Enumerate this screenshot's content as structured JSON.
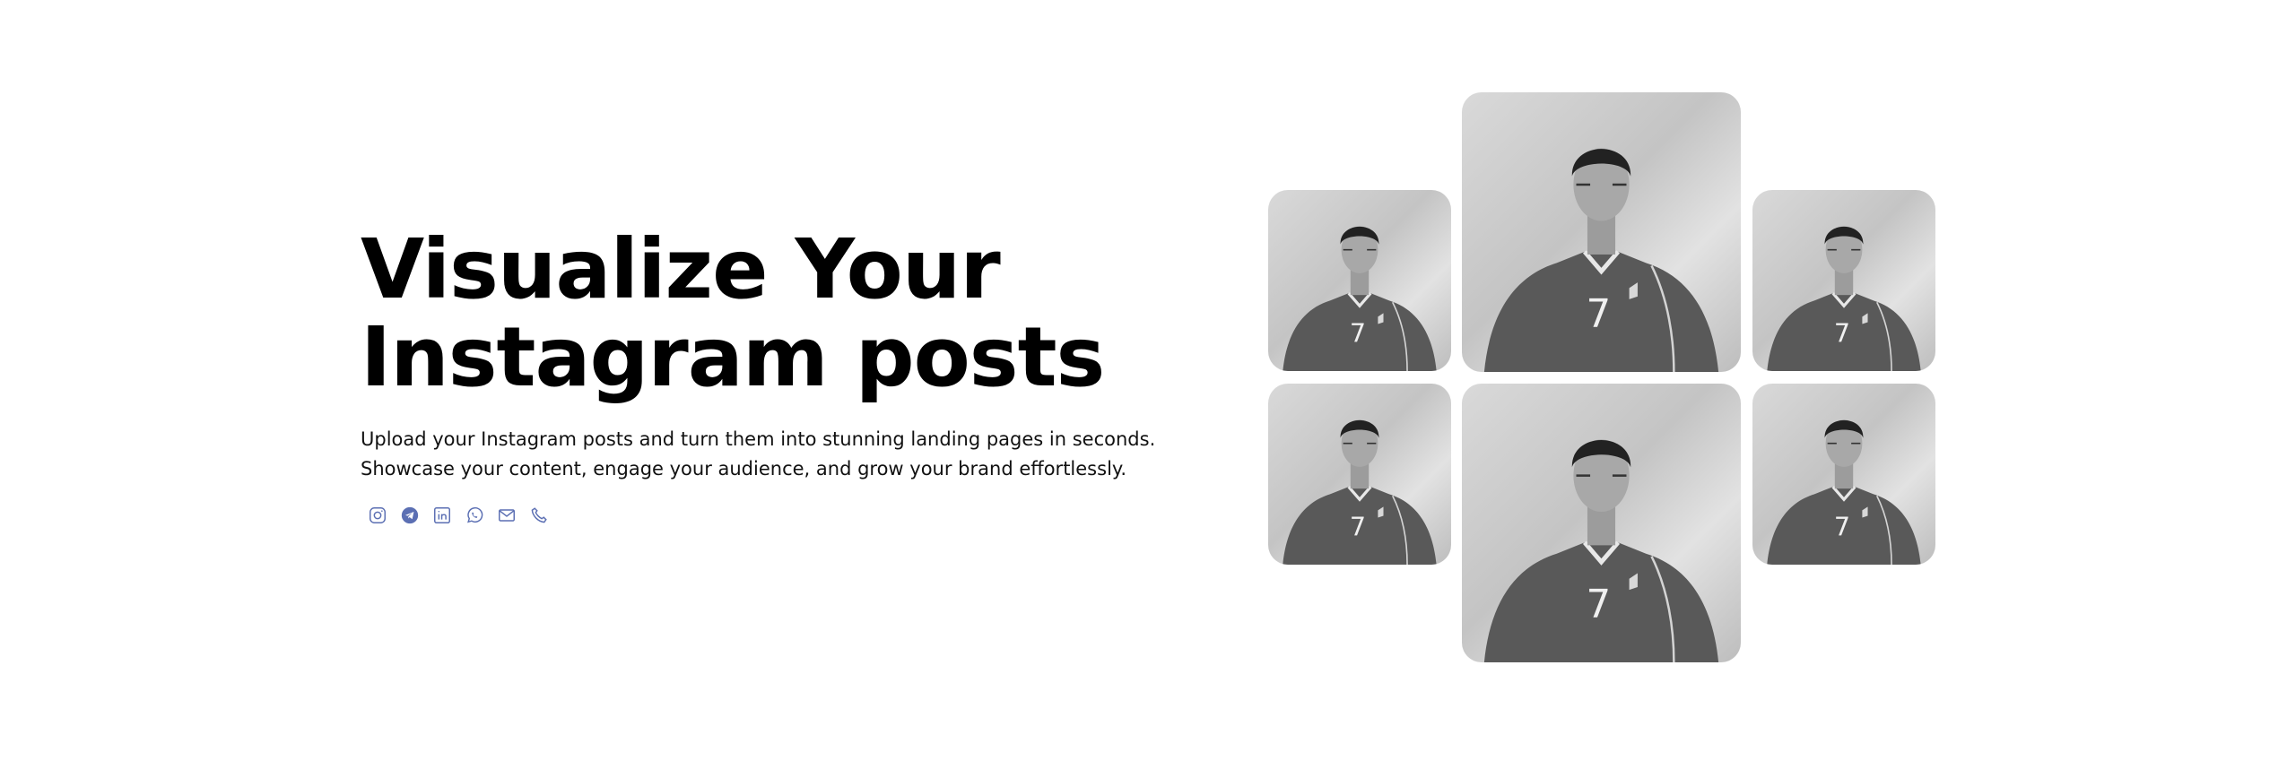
{
  "hero": {
    "title_line1": "Visualize Your",
    "title_line2": "Instagram posts",
    "subtitle": "Upload your Instagram posts and turn them into stunning landing pages in seconds. Showcase your content, engage your audience, and grow your brand effortlessly."
  },
  "social_icons": [
    "instagram-icon",
    "telegram-icon",
    "linkedin-icon",
    "whatsapp-icon",
    "email-icon",
    "phone-icon"
  ],
  "icon_color": "#5b6fb3",
  "gallery": {
    "jersey_number": "7",
    "tiles": [
      "small-left-top",
      "large-center-top",
      "small-right-top",
      "small-left-bottom",
      "large-center-bottom",
      "small-right-bottom"
    ]
  }
}
